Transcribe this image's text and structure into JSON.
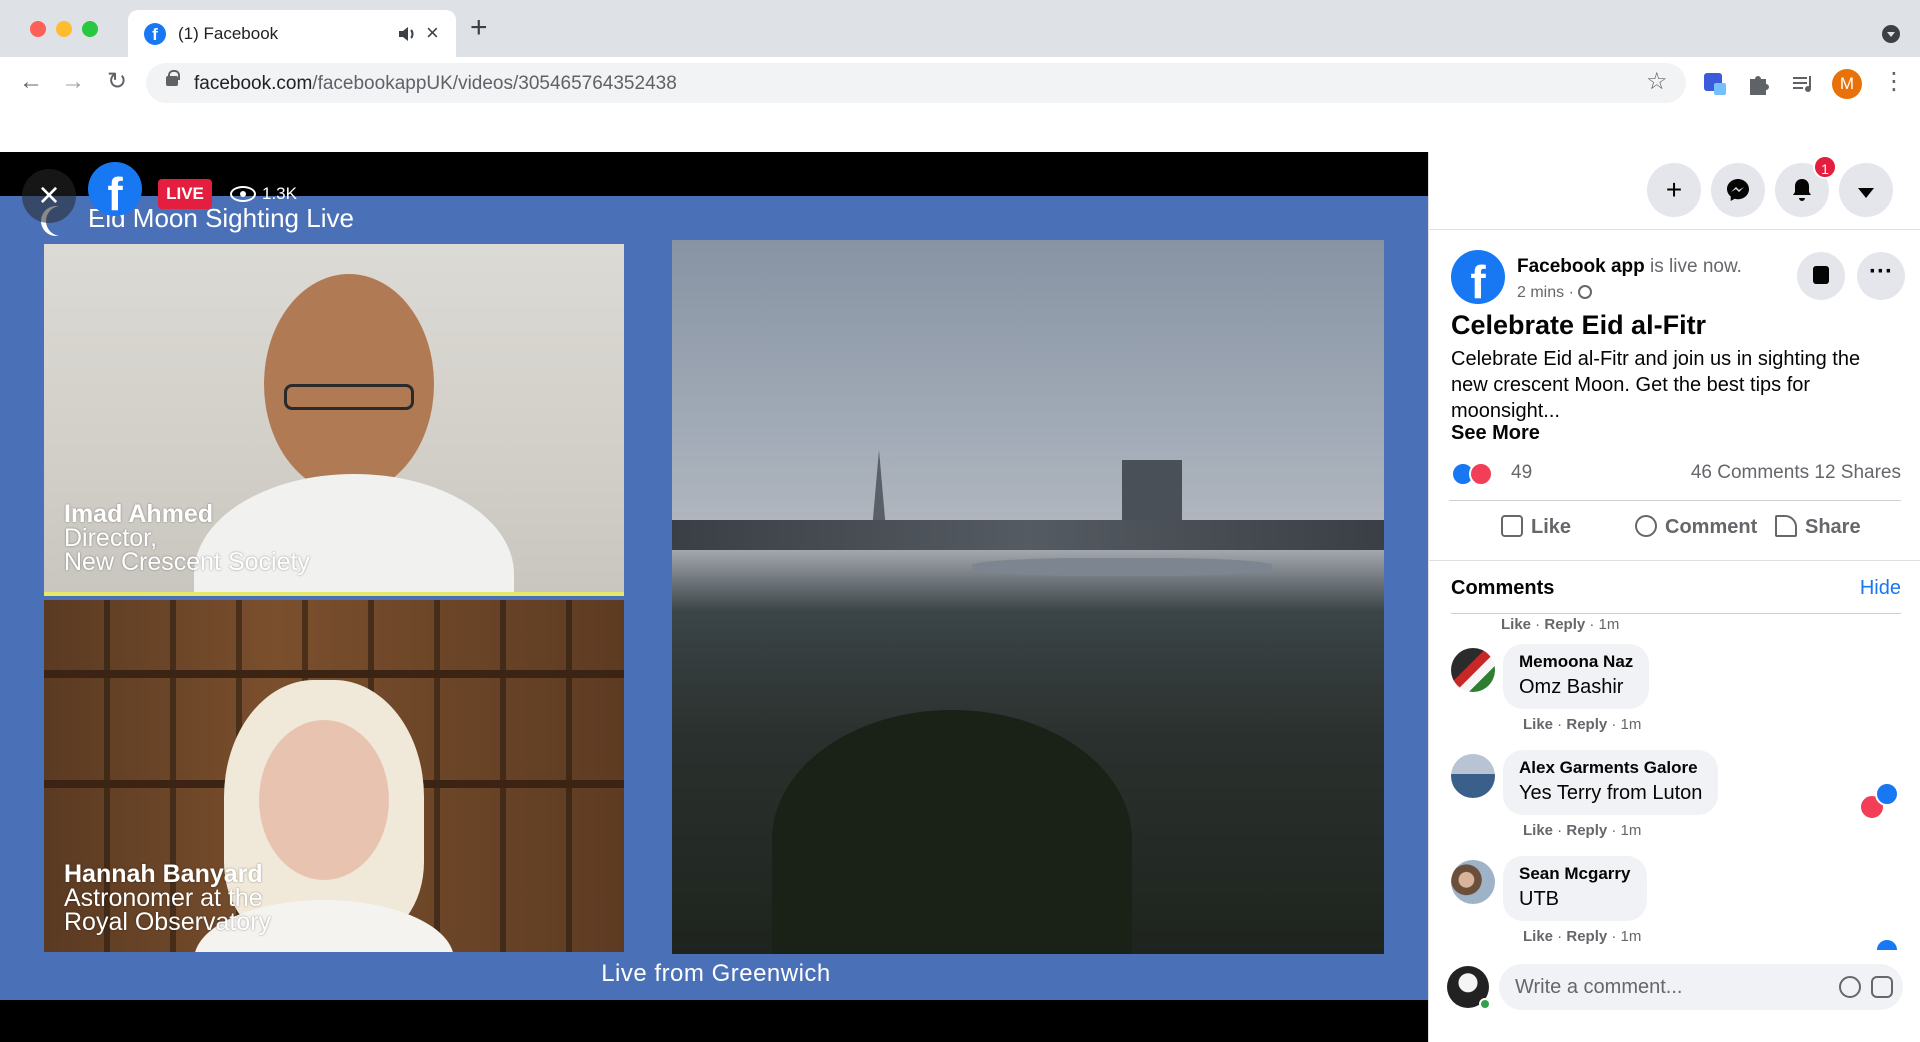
{
  "browser": {
    "tab_title": "(1) Facebook",
    "url_domain": "facebook.com",
    "url_path": "/facebookappUK/videos/305465764352438",
    "profile_initial": "M"
  },
  "video": {
    "live_label": "LIVE",
    "viewers": "1.3K",
    "stage_title": "Eid Moon Sighting Live",
    "speaker1": {
      "name": "Imad Ahmed",
      "role1": "Director,",
      "role2": "New Crescent Society"
    },
    "speaker2": {
      "name": "Hannah Banyard",
      "role1": "Astronomer at the",
      "role2": "Royal Observatory"
    },
    "footer": "Live from Greenwich"
  },
  "nav": {
    "notifications_count": "1"
  },
  "post": {
    "author": "Facebook app",
    "status": " is live now.",
    "time": "2 mins ·",
    "title": "Celebrate Eid al-Fitr",
    "body": "Celebrate Eid al-Fitr and join us in sighting the new crescent Moon. Get the best tips for moonsight...",
    "see_more": "See More",
    "reaction_count": "49",
    "comments_shares": "46 Comments  12 Shares",
    "actions": {
      "like": "Like",
      "comment": "Comment",
      "share": "Share"
    }
  },
  "comments": {
    "title": "Comments",
    "hide": "Hide",
    "meta_like": "Like",
    "meta_reply": "Reply",
    "meta_time": "· 1m",
    "items": [
      {
        "name": "Memoona Naz",
        "text": "Omz Bashir"
      },
      {
        "name": "Alex Garments Galore",
        "text": "Yes Terry from Luton"
      },
      {
        "name": "Sean Mcgarry",
        "text": "UTB"
      }
    ],
    "compose_placeholder": "Write a comment..."
  },
  "colors": {
    "facebook_blue": "#1877f2",
    "live_red": "#e41e3f",
    "stage_blue": "#4a71b8"
  },
  "icons": [
    "facebook-icon",
    "close-icon",
    "eye-icon",
    "plus-icon",
    "messenger-icon",
    "bell-icon",
    "caret-down-icon",
    "save-icon",
    "more-icon",
    "globe-icon",
    "like-icon",
    "comment-icon",
    "share-icon",
    "emoji-icon",
    "sticker-icon",
    "star-icon",
    "extensions-icon"
  ]
}
